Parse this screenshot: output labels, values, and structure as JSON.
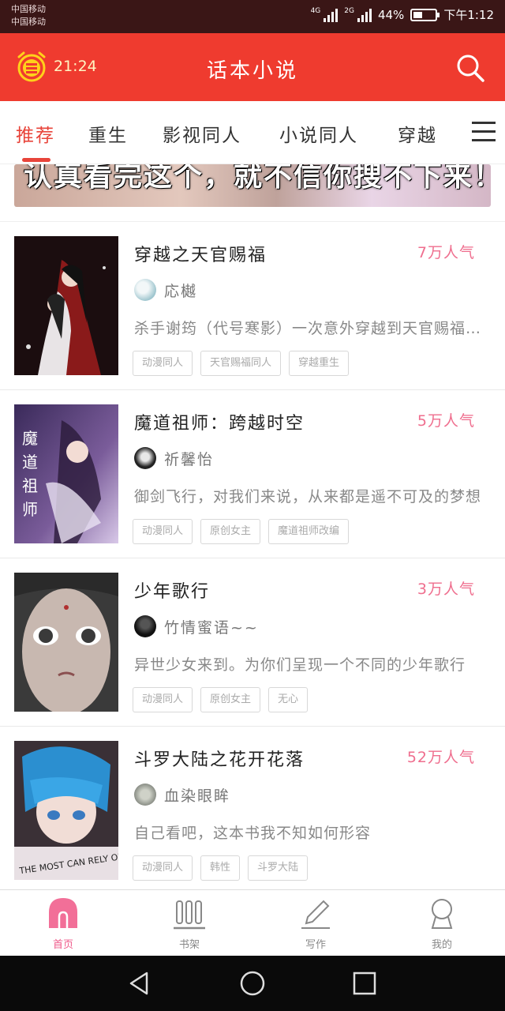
{
  "status_bar": {
    "carrier_1": "中国移动",
    "carrier_2": "中国移动",
    "net_1": "4G",
    "net_2": "2G",
    "battery_text": "44%",
    "battery_level": 0.44,
    "time": "下午1:12"
  },
  "app_bar": {
    "timer": "21:24",
    "title": "话本小说",
    "clock_icon": "alarm-clock-icon",
    "search_icon": "search-icon"
  },
  "tabs": {
    "items": [
      "推荐",
      "重生",
      "影视同人",
      "小说同人",
      "穿越"
    ],
    "active_index": 0,
    "menu_icon": "hamburger-menu-icon"
  },
  "banner": {
    "text": "认真看完这个，就不信你搜不下来！"
  },
  "books": [
    {
      "title": "穿越之天官赐福",
      "popularity": "7万人气",
      "author": "応樾",
      "description": "杀手谢筠（代号寒影）一次意外穿越到天官赐福的世界",
      "tags": [
        "动漫同人",
        "天官赐福同人",
        "穿越重生"
      ]
    },
    {
      "title": "魔道祖师：跨越时空",
      "popularity": "5万人气",
      "author": "祈馨怡",
      "description": "御剑飞行，对我们来说，从来都是遥不可及的梦想",
      "tags": [
        "动漫同人",
        "原创女主",
        "魔道祖师改编"
      ]
    },
    {
      "title": "少年歌行",
      "popularity": "3万人气",
      "author": "竹情蜜语~~",
      "description": "异世少女来到。为你们呈现一个不同的少年歌行",
      "tags": [
        "动漫同人",
        "原创女主",
        "无心"
      ]
    },
    {
      "title": "斗罗大陆之花开花落",
      "popularity": "52万人气",
      "author": "血染眼眸",
      "description": "自己看吧，这本书我不知如何形容",
      "tags": [
        "动漫同人",
        "韩性",
        "斗罗大陆"
      ]
    }
  ],
  "bottom_nav": {
    "items": [
      {
        "label": "首页",
        "icon": "home-icon"
      },
      {
        "label": "书架",
        "icon": "bookshelf-icon"
      },
      {
        "label": "写作",
        "icon": "pencil-icon"
      },
      {
        "label": "我的",
        "icon": "profile-icon"
      }
    ],
    "active_index": 0
  },
  "colors": {
    "app_bar": "#ef3b2f",
    "accent": "#e8443a",
    "popularity": "#ef6e8e",
    "nav_active": "#ef5a8a"
  }
}
